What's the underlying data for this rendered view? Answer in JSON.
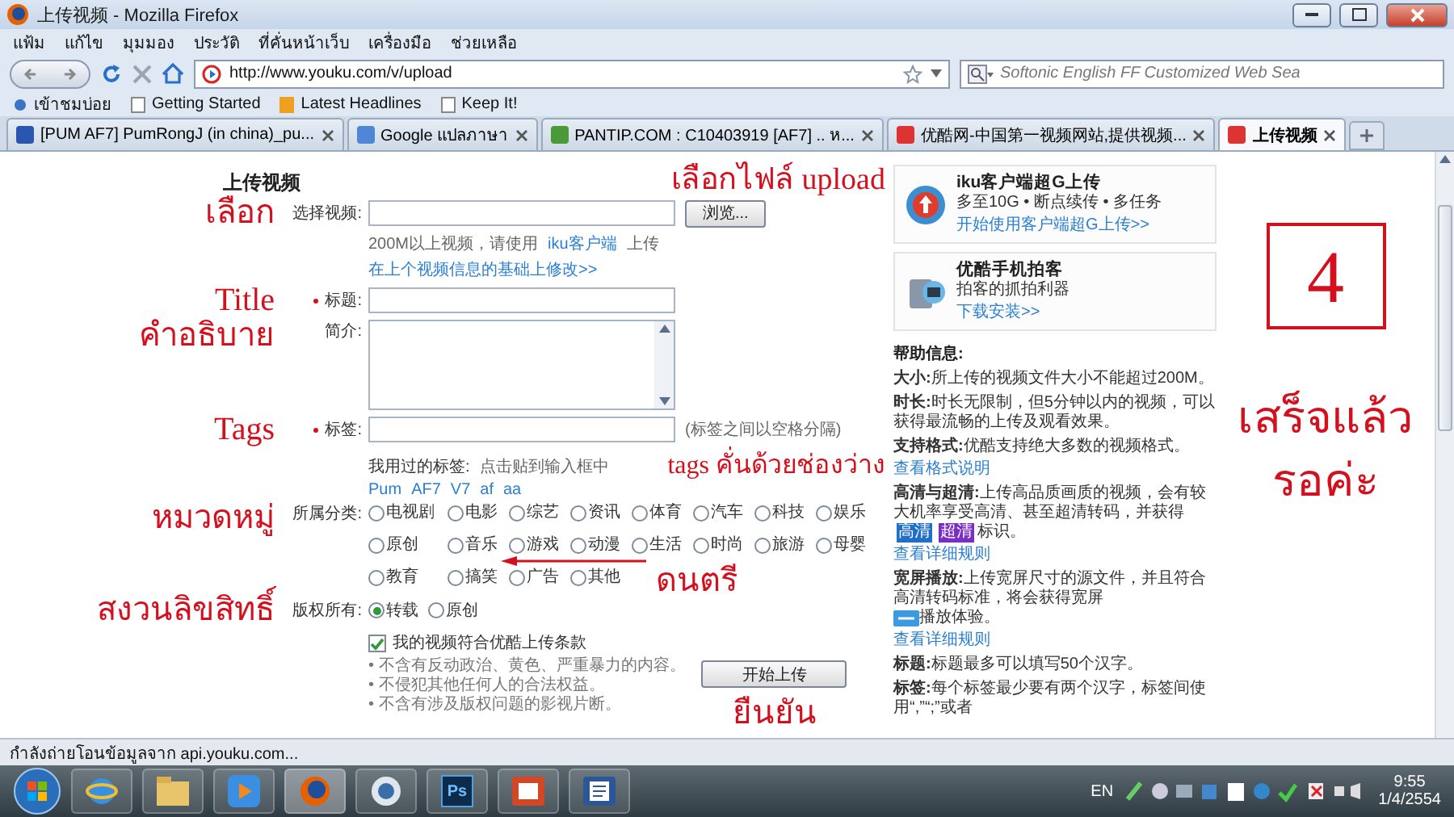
{
  "window": {
    "title": "上传视频 - Mozilla Firefox"
  },
  "menu": [
    "แฟ้ม",
    "แก้ไข",
    "มุมมอง",
    "ประวัติ",
    "ที่คั่นหน้าเว็บ",
    "เครื่องมือ",
    "ช่วยเหลือ"
  ],
  "address": {
    "url": "http://www.youku.com/v/upload"
  },
  "search": {
    "placeholder": "Softonic English FF Customized Web Sea"
  },
  "bookmarks": [
    "เข้าชมบ่อย",
    "Getting Started",
    "Latest Headlines",
    "Keep It!"
  ],
  "tabs": [
    {
      "label": "[PUM AF7] PumRongJ (in china)_pu...",
      "selected": false
    },
    {
      "label": "Google แปลภาษา",
      "selected": false
    },
    {
      "label": "PANTIP.COM : C10403919 [AF7] .. ห...",
      "selected": false
    },
    {
      "label": "优酷网-中国第一视频网站,提供视频...",
      "selected": false
    },
    {
      "label": "上传视频",
      "selected": true
    }
  ],
  "form": {
    "heading": "上传视频",
    "file": {
      "label": "选择视频:",
      "button": "浏览...",
      "hint_before": "200M以上视频，请使用",
      "hint_link": "iku客户端",
      "hint_after": "上传"
    },
    "reuse_link": "在上个视频信息的基础上修改>>",
    "title": {
      "label": "标题:",
      "required": true
    },
    "description": {
      "label": "简介:"
    },
    "tags": {
      "label": "标签:",
      "required": true,
      "note": "(标签之间以空格分隔)"
    },
    "used_tags": {
      "label": "我用过的标签:",
      "hint": "点击贴到输入框中",
      "items": [
        "Pum",
        "AF7",
        "V7",
        "af",
        "aa"
      ]
    },
    "category": {
      "label": "所属分类:",
      "options": [
        {
          "label": "电视剧",
          "selected": false
        },
        {
          "label": "电影",
          "selected": false
        },
        {
          "label": "综艺",
          "selected": false
        },
        {
          "label": "资讯",
          "selected": false
        },
        {
          "label": "体育",
          "selected": false
        },
        {
          "label": "汽车",
          "selected": false
        },
        {
          "label": "科技",
          "selected": false
        },
        {
          "label": "娱乐",
          "selected": false
        },
        {
          "label": "原创",
          "selected": false
        },
        {
          "label": "音乐",
          "selected": false
        },
        {
          "label": "游戏",
          "selected": false
        },
        {
          "label": "动漫",
          "selected": false
        },
        {
          "label": "生活",
          "selected": false
        },
        {
          "label": "时尚",
          "selected": false
        },
        {
          "label": "旅游",
          "selected": false
        },
        {
          "label": "母婴",
          "selected": false
        },
        {
          "label": "教育",
          "selected": false
        },
        {
          "label": "搞笑",
          "selected": false
        },
        {
          "label": "广告",
          "selected": false
        },
        {
          "label": "其他",
          "selected": false
        }
      ]
    },
    "copyright": {
      "label": "版权所有:",
      "options": [
        {
          "label": "转载",
          "selected": true
        },
        {
          "label": "原创",
          "selected": false
        }
      ]
    },
    "agree": {
      "label": "我的视频符合优酷上传条款",
      "checked": true
    },
    "rules": [
      "• 不含有反动政治、黄色、严重暴力的内容。",
      "• 不侵犯其他任何人的合法权益。",
      "• 不含有涉及版权问题的影视片断。"
    ],
    "submit": "开始上传"
  },
  "sidebar": {
    "cards": [
      {
        "title": "iku客户端超G上传",
        "text": "多至10G • 断点续传 • 多任务",
        "link": "开始使用客户端超G上传>>"
      },
      {
        "title": "优酷手机拍客",
        "text": "拍客的抓拍利器",
        "link": "下载安装>>"
      }
    ],
    "help_title": "帮助信息:",
    "help": [
      {
        "kind": "text",
        "term": "大小:",
        "text": "所上传的视频文件大小不能超过200M。"
      },
      {
        "kind": "text",
        "term": "时长:",
        "text": "时长无限制，但5分钟以内的视频，可以获得最流畅的上传及观看效果。"
      },
      {
        "kind": "text",
        "term": "支持格式:",
        "text": "优酷支持绝大多数的视频格式。",
        "link": "查看格式说明"
      },
      {
        "kind": "badges",
        "term": "高清与超清:",
        "text": "上传高品质画质的视频，会有较大机率享受高清、甚至超清转码，并获得",
        "badges": [
          {
            "label": "高清",
            "color": "#1f6fc8"
          },
          {
            "label": "超清",
            "color": "#7a2fc4"
          }
        ],
        "text_after": "标识。",
        "link": "查看详细规则"
      },
      {
        "kind": "icon",
        "term": "宽屏播放:",
        "text": "上传宽屏尺寸的源文件，并且符合高清转码标准，将会获得宽屏",
        "text_after": "播放体验。",
        "link": "查看详细规则"
      },
      {
        "kind": "text",
        "term": "标题:",
        "text": "标题最多可以填写50个汉字。"
      },
      {
        "kind": "text",
        "term": "标签:",
        "text": "每个标签最少要有两个汉字，标签间使用“,”“;”或者"
      }
    ]
  },
  "annotations": {
    "choose_file": "เลือกไฟล์ upload",
    "choose": "เลือก",
    "title": "Title",
    "description": "คำอธิบาย",
    "tags": "Tags",
    "tags_hint": "tags คั่นด้วยช่องว่าง",
    "category": "หมวดหมู่",
    "copyright": "สงวนลิขสิทธิ์",
    "music": "ดนตรี",
    "confirm": "ยืนยัน",
    "step": "4",
    "done": "เสร็จแล้วรอค่ะ"
  },
  "status_bar": "กำลังถ่ายโอนข้อมูลจาก api.youku.com...",
  "taskbar": {
    "ps_label": "Ps",
    "lang": "EN",
    "time": "9:55",
    "date": "1/4/2554"
  }
}
